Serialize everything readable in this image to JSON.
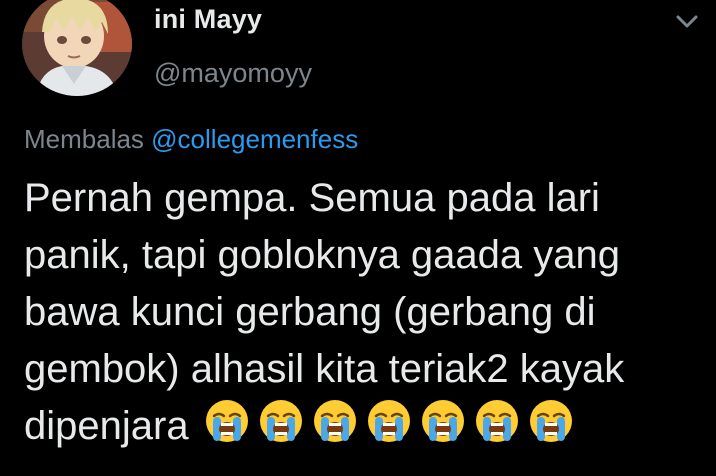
{
  "author": {
    "display_name": "ini Mayy",
    "handle": "@mayomoyy"
  },
  "reply": {
    "prefix": "Membalas ",
    "mention": "@collegemenfess"
  },
  "tweet": {
    "text": "Pernah gempa. Semua pada lari\npanik, tapi gobloknya gaada yang\nbawa kunci gerbang (gerbang di\ngembok) alhasil kita teriak2 kayak\ndipenjara",
    "emoji_count": 7,
    "emoji_name": "loudly-crying-face"
  },
  "icons": {
    "menu": "chevron-down-icon",
    "avatar": "anime-character-avatar"
  },
  "colors": {
    "background": "#000000",
    "primary_text": "#e7e9ea",
    "secondary_text": "#7d858d",
    "link": "#2b9bf0"
  }
}
